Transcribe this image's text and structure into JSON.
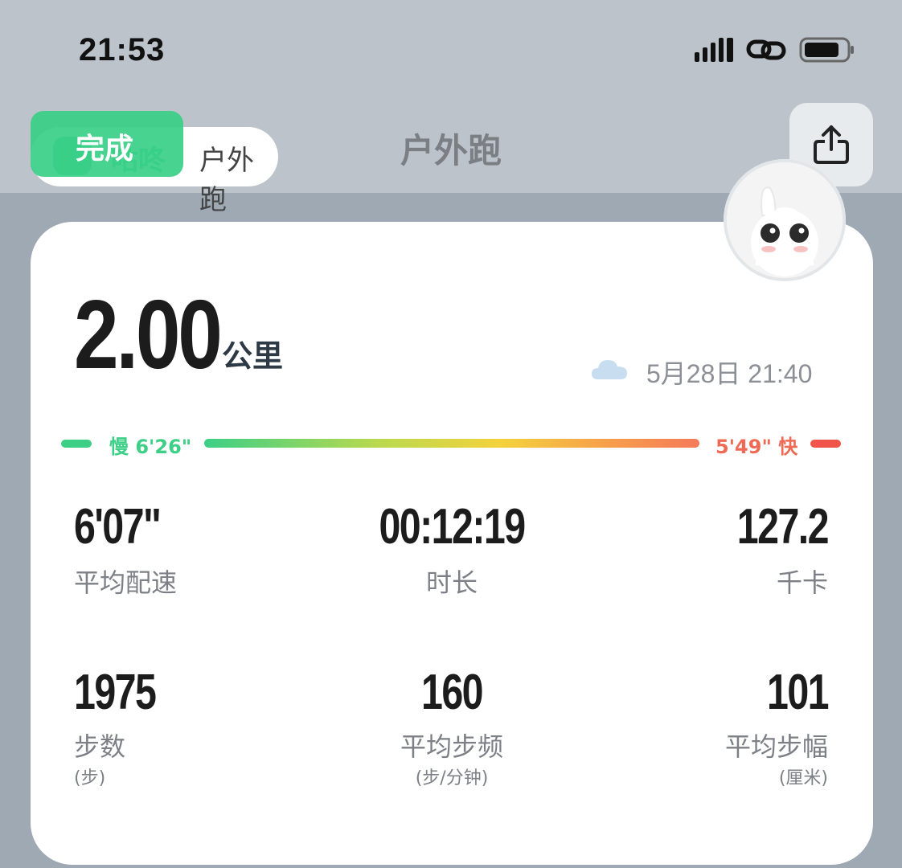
{
  "status_bar": {
    "time": "21:53"
  },
  "header": {
    "done_label": "完成",
    "source_brand": "咕咚",
    "source_sport": "户外跑",
    "title": "户外跑"
  },
  "summary": {
    "distance": "2.00",
    "distance_unit": "公里",
    "weather_icon": "cloud-icon",
    "datetime": "5月28日 21:40"
  },
  "pace_bar": {
    "slow_label": "慢 6'26\"",
    "fast_label": "5'49\" 快",
    "colors": {
      "slow": "#3ccf86",
      "fast": "#f0544a"
    }
  },
  "stats": {
    "avg_pace": {
      "value": "6'07\"",
      "label": "平均配速"
    },
    "duration": {
      "value": "00:12:19",
      "label": "时长"
    },
    "calories": {
      "value": "127.2",
      "label": "千卡"
    },
    "steps": {
      "value": "1975",
      "label": "步数",
      "sub": "(步)"
    },
    "cadence": {
      "value": "160",
      "label": "平均步频",
      "sub": "(步/分钟)"
    },
    "stride": {
      "value": "101",
      "label": "平均步幅",
      "sub": "(厘米)"
    }
  }
}
